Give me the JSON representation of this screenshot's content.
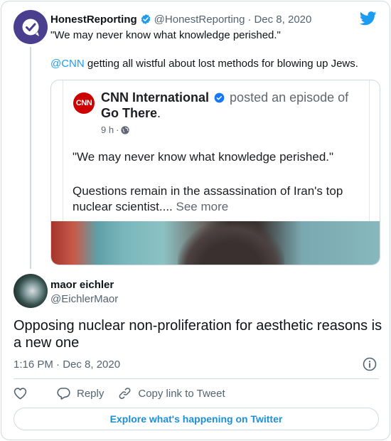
{
  "quoted_tweet": {
    "author_name": "HonestReporting",
    "author_handle": "@HonestReporting",
    "separator": "·",
    "date": "Dec 8, 2020",
    "line1": "\"We may never know what knowledge perished.\"",
    "mention": "@CNN",
    "line2_rest": " getting all wistful about lost methods for blowing up Jews.",
    "embed": {
      "page_name": "CNN International",
      "posted_text": "posted an episode of",
      "show_name": "Go There",
      "period": ".",
      "time": "9 h",
      "time_sep": "·",
      "logo_text": "CNN",
      "quote": "\"We may never know what knowledge perished.\"",
      "body": "Questions remain in the assassination of Iran's top nuclear scientist....",
      "see_more": "See more"
    }
  },
  "main_tweet": {
    "author_name": "maor eichler",
    "author_handle": "@EichlerMaor",
    "text": "Opposing nuclear non-proliferation for aesthetic reasons is a new one",
    "timestamp": "1:16 PM · Dec 8, 2020"
  },
  "actions": {
    "reply_label": "Reply",
    "copy_link_label": "Copy link to Tweet"
  },
  "explore_button_label": "Explore what's happening on Twitter",
  "colors": {
    "twitter_blue": "#1d9bf0",
    "link_blue": "#1d8fd7",
    "cnn_red": "#cc0000",
    "text_primary": "#0f1419",
    "text_secondary": "#536471",
    "border": "#cfd9de"
  },
  "icons": [
    "honestreporting-logo-icon",
    "verified-badge-icon",
    "twitter-bird-icon",
    "cnn-logo-icon",
    "globe-icon",
    "info-icon",
    "heart-icon",
    "reply-bubble-icon",
    "link-icon"
  ]
}
